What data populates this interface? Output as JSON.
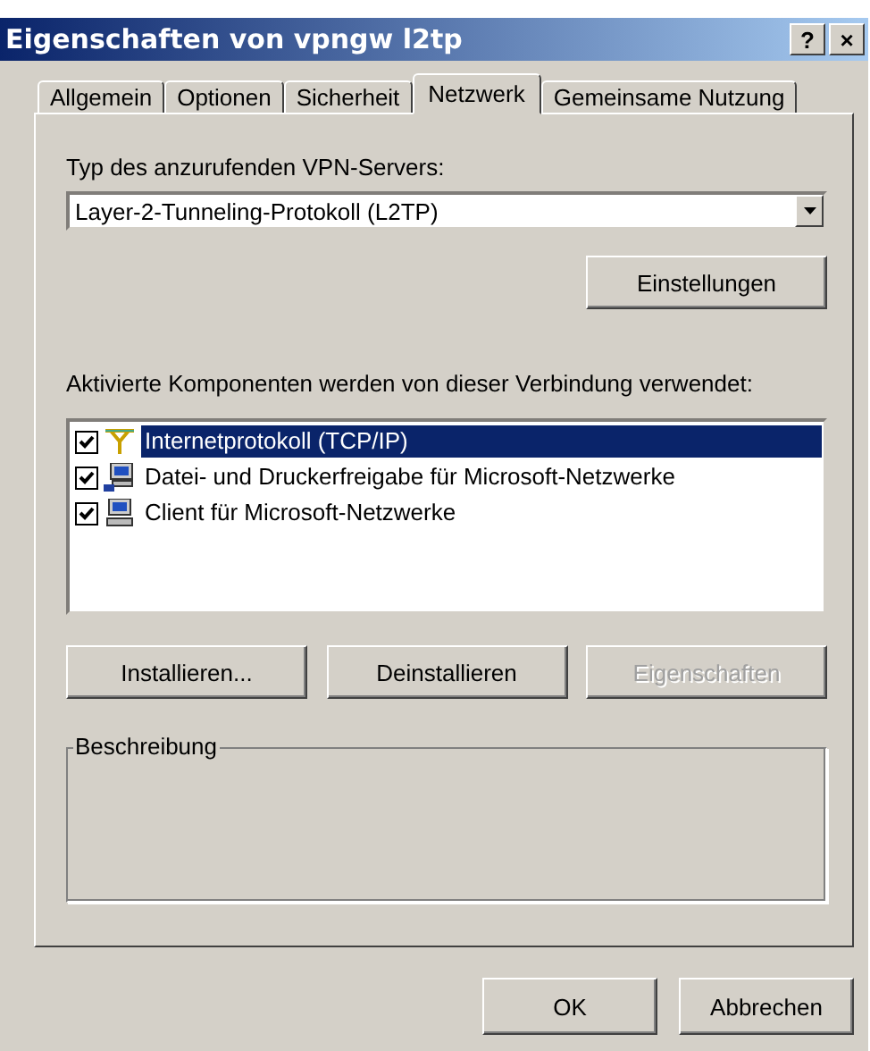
{
  "window": {
    "title": "Eigenschaften von vpngw l2tp",
    "title_buttons": [
      "?",
      "×"
    ]
  },
  "tabs": [
    {
      "label": "Allgemein",
      "selected": false
    },
    {
      "label": "Optionen",
      "selected": false
    },
    {
      "label": "Sicherheit",
      "selected": false
    },
    {
      "label": "Netzwerk",
      "selected": true
    },
    {
      "label": "Gemeinsame Nutzung",
      "selected": false
    }
  ],
  "vpn_type": {
    "label": "Typ des anzurufenden VPN-Servers:",
    "value": "Layer-2-Tunneling-Protokoll (L2TP)",
    "settings_button": "Einstellungen"
  },
  "components": {
    "label": "Aktivierte Komponenten werden von dieser Verbindung verwendet:",
    "items": [
      {
        "label": "Internetprotokoll (TCP/IP)",
        "kind": "protocol",
        "checked": true,
        "selected": true
      },
      {
        "label": "Datei- und Druckerfreigabe für Microsoft-Netzwerke",
        "kind": "service",
        "checked": true,
        "selected": false
      },
      {
        "label": "Client für Microsoft-Netzwerke",
        "kind": "client",
        "checked": true,
        "selected": false
      }
    ]
  },
  "component_buttons": [
    {
      "label": "Installieren...",
      "disabled": false
    },
    {
      "label": "Deinstallieren",
      "disabled": false
    },
    {
      "label": "Eigenschaften",
      "disabled": true
    }
  ],
  "description": {
    "title": "Beschreibung"
  },
  "buttons": [
    "OK",
    "Abbrechen"
  ]
}
